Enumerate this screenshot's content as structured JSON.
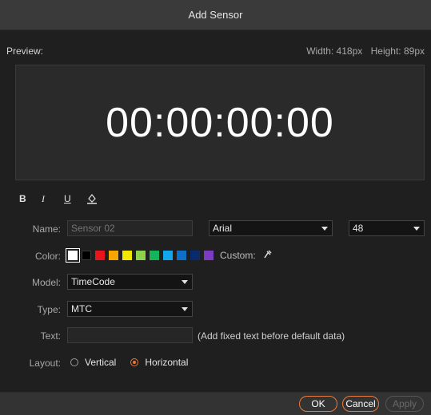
{
  "dialog": {
    "title": "Add Sensor"
  },
  "preview": {
    "label": "Preview:",
    "width_text": "Width: 418px",
    "height_text": "Height: 89px",
    "display_text": "00:00:00:00"
  },
  "formatting": {
    "bold": "B",
    "italic": "I",
    "underline": "U",
    "fill": "A"
  },
  "form": {
    "name": {
      "label": "Name:",
      "placeholder": "Sensor 02"
    },
    "font": {
      "value": "Arial"
    },
    "font_size": {
      "value": "48"
    },
    "color": {
      "label": "Color:",
      "swatches": [
        "#ffffff",
        "#000000",
        "#e8141c",
        "#f7a500",
        "#f2e700",
        "#8ed14a",
        "#17b35a",
        "#12a6ea",
        "#0f6fc7",
        "#0a2a6e",
        "#7a3cc2"
      ],
      "selected_index": 0,
      "custom_label": "Custom:"
    },
    "model": {
      "label": "Model:",
      "value": "TimeCode"
    },
    "type": {
      "label": "Type:",
      "value": "MTC"
    },
    "text": {
      "label": "Text:",
      "value": "",
      "hint": "(Add fixed text before default data)"
    },
    "layout": {
      "label": "Layout:",
      "options": [
        "Vertical",
        "Horizontal"
      ],
      "selected": "Horizontal"
    }
  },
  "buttons": {
    "ok": "OK",
    "cancel": "Cancel",
    "apply": "Apply"
  },
  "colors": {
    "accent": "#e67a3a",
    "background": "#1f1f1f",
    "titlebar": "#3a3a3a"
  }
}
